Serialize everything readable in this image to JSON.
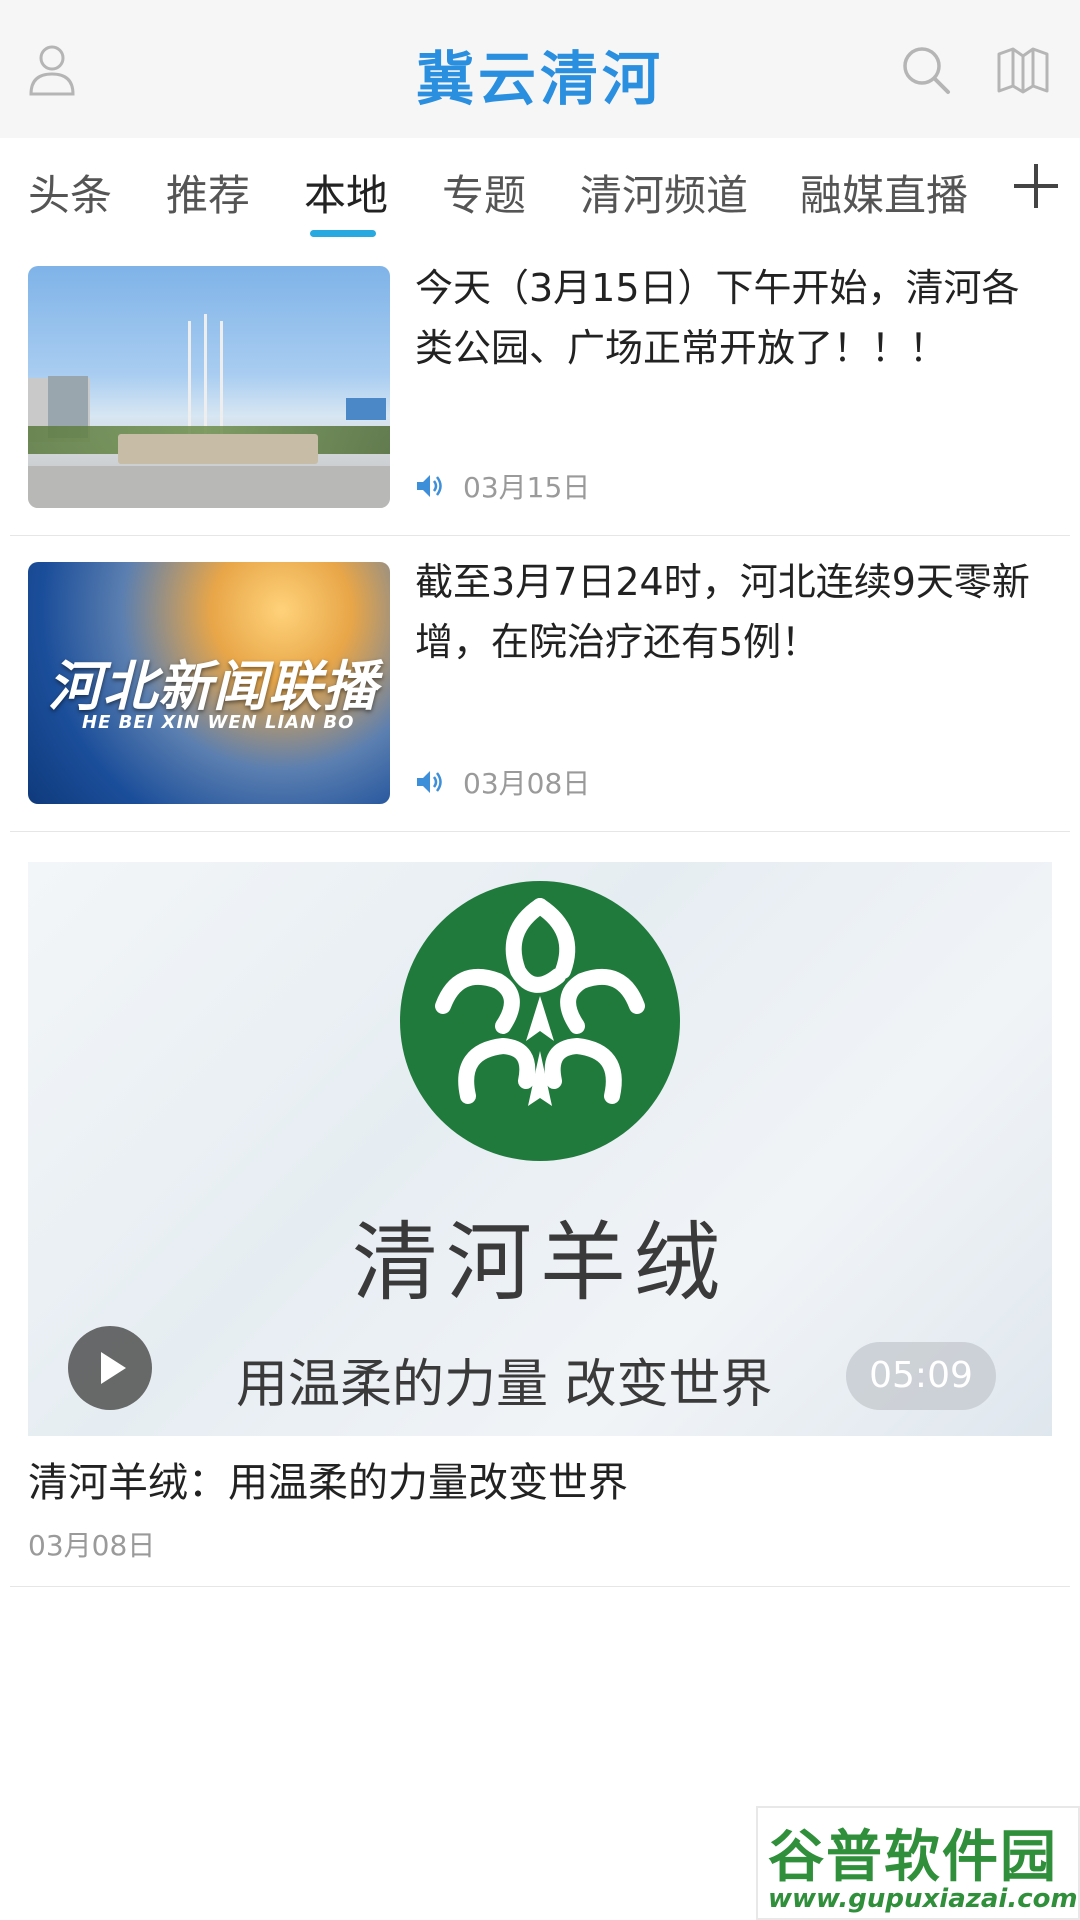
{
  "header": {
    "title": "冀云清河",
    "icons": [
      "user-icon",
      "search-icon",
      "map-icon"
    ]
  },
  "tabs": [
    {
      "label": "头条"
    },
    {
      "label": "推荐"
    },
    {
      "label": "本地",
      "active": true
    },
    {
      "label": "专题"
    },
    {
      "label": "清河频道"
    },
    {
      "label": "融媒直播"
    }
  ],
  "news": [
    {
      "title": "今天（3月15日）下午开始，清河各类公园、广场正常开放了！！！",
      "date": "03月15日",
      "has_audio": true
    },
    {
      "title": "截至3月7日24时，河北连续9天零新增，在院治疗还有5例！",
      "date": "03月08日",
      "has_audio": true,
      "thumb_text_cn": "河北新闻联播",
      "thumb_text_en": "HE BEI XIN WEN LIAN BO"
    }
  ],
  "video": {
    "brand": "清河羊绒",
    "slogan": "用温柔的力量 改变世界",
    "duration": "05:09",
    "title": "清河羊绒：用温柔的力量改变世界",
    "date": "03月08日"
  },
  "watermark": {
    "name": "谷普软件园",
    "url": "www.gupuxiazai.com"
  },
  "colors": {
    "accent": "#2b8fe0",
    "tab_underline": "#28a9e0",
    "emblem_green": "#1f7a3c",
    "date_gray": "#9a9a9a"
  }
}
